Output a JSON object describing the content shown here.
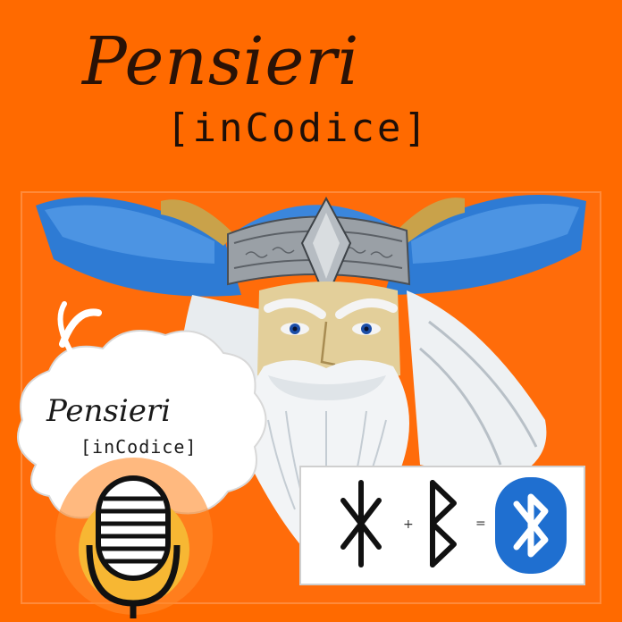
{
  "logo": {
    "title_script": "Pensieri",
    "title_mono": "[inCodice]"
  },
  "badge": {
    "title_script": "Pensieri",
    "title_mono": "[inCodice]"
  },
  "rune_equation": {
    "plus": "+",
    "equals": "=",
    "result_icon": "bluetooth-icon"
  },
  "colors": {
    "background": "#ff6a00",
    "helmet_blue": "#2e7bd4",
    "bluetooth_blue": "#1f6fd0"
  }
}
